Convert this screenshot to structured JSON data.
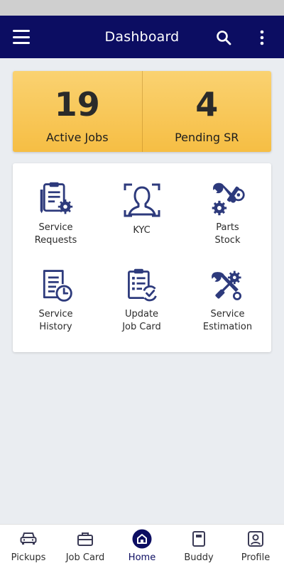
{
  "app_bar": {
    "title": "Dashboard",
    "menu_icon": "menu-icon",
    "search_icon": "search-icon",
    "more_icon": "more-vert-icon"
  },
  "stats": [
    {
      "value": "19",
      "label": "Active Jobs"
    },
    {
      "value": "4",
      "label": "Pending SR"
    }
  ],
  "tiles": [
    {
      "label": "Service\nRequests",
      "icon": "service-requests-icon"
    },
    {
      "label": "KYC",
      "icon": "kyc-icon"
    },
    {
      "label": "Parts\nStock",
      "icon": "parts-stock-icon"
    },
    {
      "label": "Service\nHistory",
      "icon": "service-history-icon"
    },
    {
      "label": "Update\nJob Card",
      "icon": "update-job-card-icon"
    },
    {
      "label": "Service\nEstimation",
      "icon": "service-estimation-icon"
    }
  ],
  "bottom_nav": {
    "active": "Home",
    "items": [
      {
        "label": "Pickups",
        "icon": "car-icon"
      },
      {
        "label": "Job Card",
        "icon": "briefcase-icon"
      },
      {
        "label": "Home",
        "icon": "home-icon"
      },
      {
        "label": "Buddy",
        "icon": "book-icon"
      },
      {
        "label": "Profile",
        "icon": "profile-icon"
      }
    ]
  },
  "colors": {
    "primary": "#0c0d62",
    "accent": "#f6be44",
    "icon": "#2d3a7c"
  }
}
